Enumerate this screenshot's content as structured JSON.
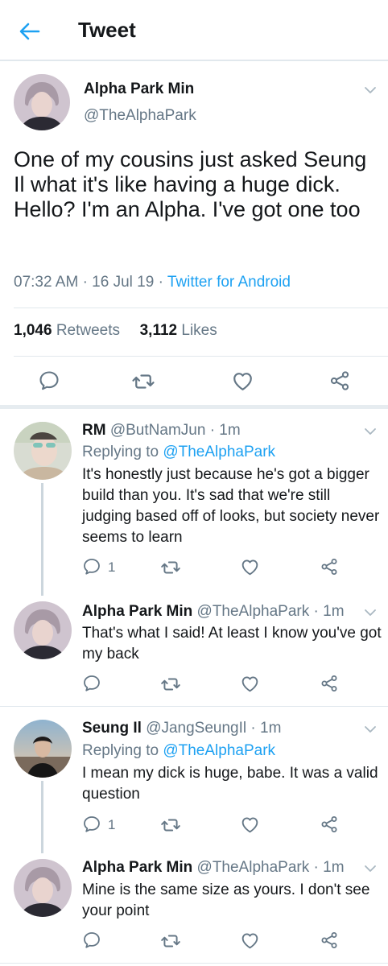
{
  "header": {
    "title": "Tweet"
  },
  "main_tweet": {
    "name": "Alpha Park Min",
    "handle": "@TheAlphaPark",
    "text": "One of my cousins just asked Seung Il what it's like having a huge dick. Hello? I'm an Alpha. I've got one too",
    "time": "07:32 AM",
    "date": "16 Jul 19",
    "source": "Twitter for Android",
    "retweets_count": "1,046",
    "retweets_label": "Retweets",
    "likes_count": "3,112",
    "likes_label": "Likes"
  },
  "replies": [
    {
      "name": "RM",
      "handle": "@ButNamJun",
      "time": "1m",
      "replying_prefix": "Replying to",
      "replying_to": "@TheAlphaPark",
      "text": "It's honestly just because he's got a bigger build than you. It's sad that we're still judging based off of looks, but society never seems to learn",
      "reply_count": "1"
    },
    {
      "name": "Alpha Park Min",
      "handle": "@TheAlphaPark",
      "time": "1m",
      "text": "That's what I said! At least I know you've got my back"
    },
    {
      "name": "Seung Il",
      "handle": "@JangSeungIl",
      "time": "1m",
      "replying_prefix": "Replying to",
      "replying_to": "@TheAlphaPark",
      "text": "I mean my dick is huge, babe. It was a valid question",
      "reply_count": "1"
    },
    {
      "name": "Alpha Park Min",
      "handle": "@TheAlphaPark",
      "time": "1m",
      "text": "Mine is the same size as yours. I don't see your point"
    }
  ],
  "colors": {
    "accent": "#1da1f2",
    "text": "#14171a",
    "muted": "#657786",
    "divider": "#e1e8ed"
  },
  "icons": [
    "back-arrow-icon",
    "chevron-down-icon",
    "reply-icon",
    "retweet-icon",
    "like-icon",
    "share-icon"
  ]
}
